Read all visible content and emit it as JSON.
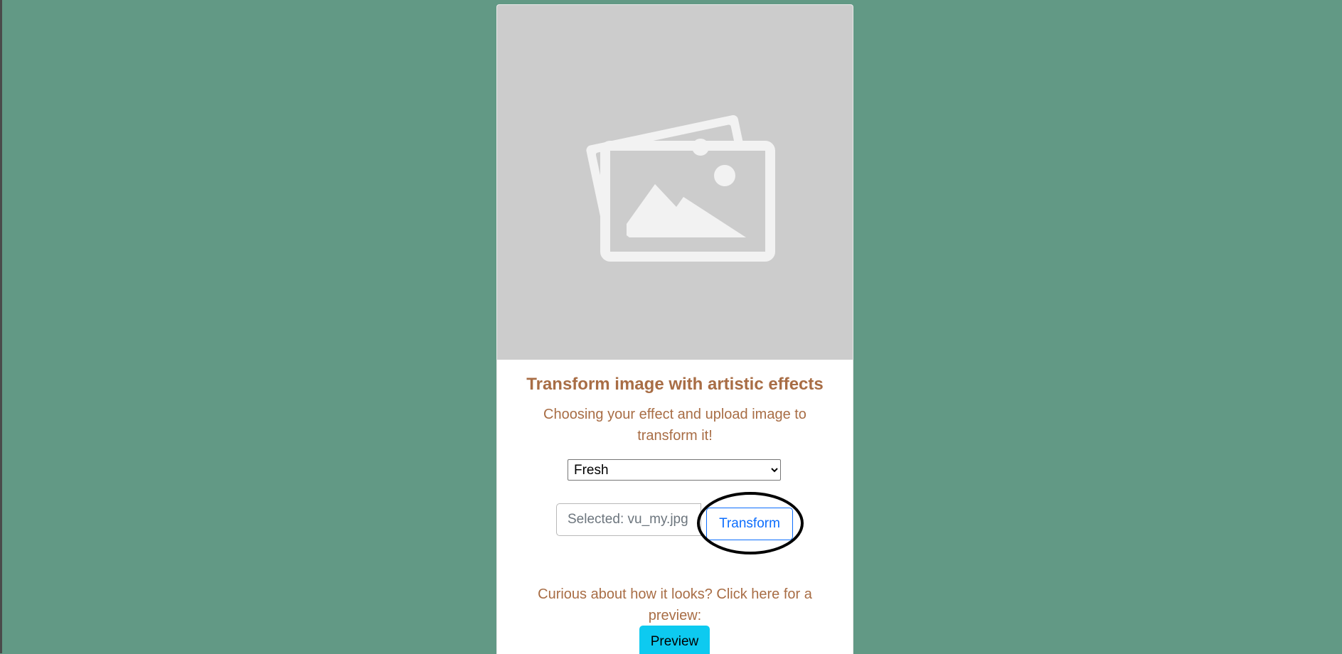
{
  "card": {
    "title": "Transform image with artistic effects",
    "subtitle": "Choosing your effect and upload image to transform it!",
    "hero_icon": "images-placeholder-icon"
  },
  "effect": {
    "selected": "Fresh"
  },
  "upload": {
    "file_label": "Selected: vu_my.jpg",
    "transform_label": "Transform"
  },
  "preview": {
    "text": "Curious about how it looks? Click here for a preview:",
    "button_label": "Preview"
  },
  "colors": {
    "page_background": "#629985",
    "card_background": "#ffffff",
    "hero_background": "#cccccc",
    "text_accent": "#a86d45",
    "primary": "#0d6efd",
    "info": "#0dcaf0"
  }
}
